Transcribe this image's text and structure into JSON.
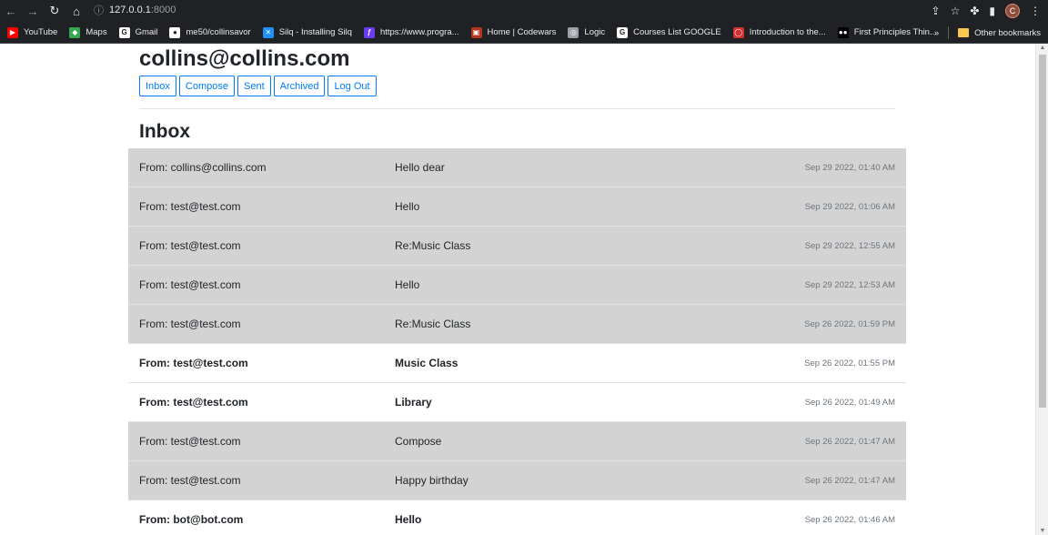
{
  "browser": {
    "url_host": "127.0.0.1",
    "url_port": ":8000",
    "avatar_letter": "C",
    "bookmarks": [
      {
        "label": "YouTube",
        "color": "#ff0000",
        "glyph": "▶"
      },
      {
        "label": "Maps",
        "color": "#34a853",
        "glyph": "◆"
      },
      {
        "label": "Gmail",
        "color": "#ffffff",
        "glyph": "G"
      },
      {
        "label": "me50/collinsavor",
        "color": "#ffffff",
        "glyph": "●"
      },
      {
        "label": "Silq - Installing Silq",
        "color": "#1e90ff",
        "glyph": "✕"
      },
      {
        "label": "https://www.progra...",
        "color": "#6a3cf0",
        "glyph": "ƒ"
      },
      {
        "label": "Home | Codewars",
        "color": "#b1361e",
        "glyph": "▣"
      },
      {
        "label": "Logic",
        "color": "#9aa0a6",
        "glyph": "◎"
      },
      {
        "label": "Courses List GOOGLE",
        "color": "#ffffff",
        "glyph": "G"
      },
      {
        "label": "Introduction to the...",
        "color": "#d32f2f",
        "glyph": "◯"
      },
      {
        "label": "First Principles Thin...",
        "color": "#000000",
        "glyph": "●●"
      }
    ],
    "overflow_label": "»",
    "other_bookmarks": "Other bookmarks"
  },
  "header": {
    "user_email": "collins@collins.com",
    "buttons": {
      "inbox": "Inbox",
      "compose": "Compose",
      "sent": "Sent",
      "archived": "Archived",
      "logout": "Log Out"
    }
  },
  "mailbox": {
    "title": "Inbox",
    "emails": [
      {
        "sender": "From: collins@collins.com",
        "subject": "Hello dear",
        "timestamp": "Sep 29 2022, 01:40 AM",
        "read": true
      },
      {
        "sender": "From: test@test.com",
        "subject": "Hello",
        "timestamp": "Sep 29 2022, 01:06 AM",
        "read": true
      },
      {
        "sender": "From: test@test.com",
        "subject": "Re:Music Class",
        "timestamp": "Sep 29 2022, 12:55 AM",
        "read": true
      },
      {
        "sender": "From: test@test.com",
        "subject": "Hello",
        "timestamp": "Sep 29 2022, 12:53 AM",
        "read": true
      },
      {
        "sender": "From: test@test.com",
        "subject": "Re:Music Class",
        "timestamp": "Sep 26 2022, 01:59 PM",
        "read": true
      },
      {
        "sender": "From: test@test.com",
        "subject": "Music Class",
        "timestamp": "Sep 26 2022, 01:55 PM",
        "read": false
      },
      {
        "sender": "From: test@test.com",
        "subject": "Library",
        "timestamp": "Sep 26 2022, 01:49 AM",
        "read": false
      },
      {
        "sender": "From: test@test.com",
        "subject": "Compose",
        "timestamp": "Sep 26 2022, 01:47 AM",
        "read": true
      },
      {
        "sender": "From: test@test.com",
        "subject": "Happy birthday",
        "timestamp": "Sep 26 2022, 01:47 AM",
        "read": true
      },
      {
        "sender": "From: bot@bot.com",
        "subject": "Hello",
        "timestamp": "Sep 26 2022, 01:46 AM",
        "read": false
      }
    ]
  }
}
